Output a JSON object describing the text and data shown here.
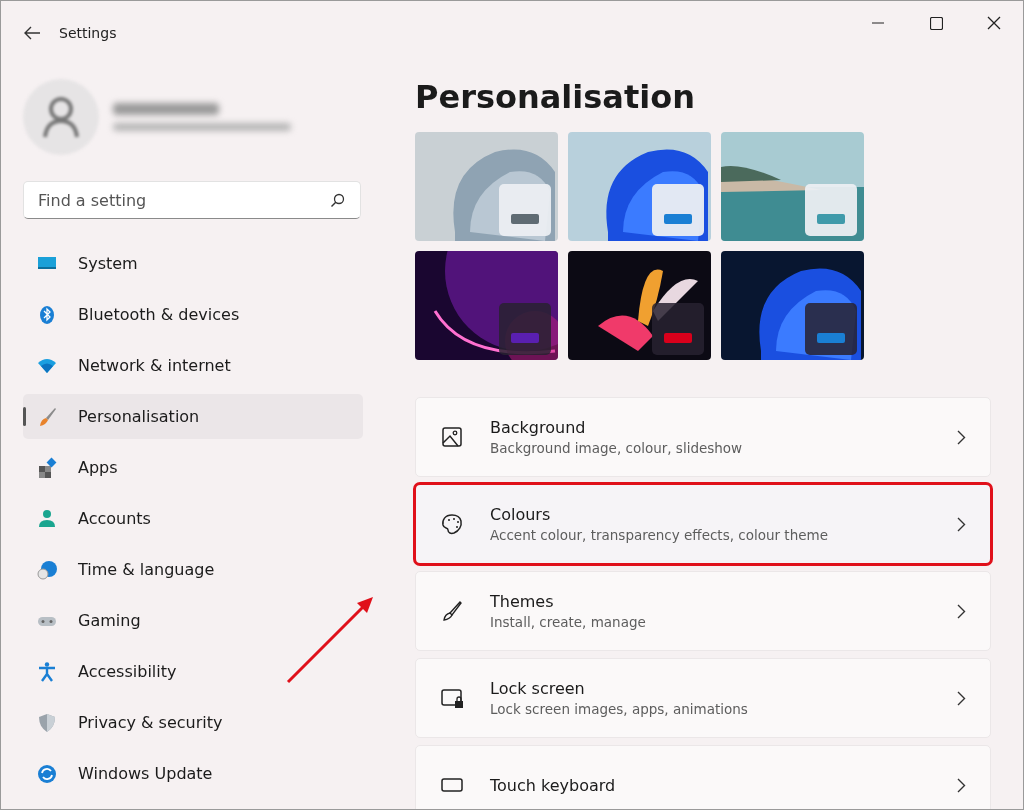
{
  "window": {
    "title": "Settings"
  },
  "search": {
    "placeholder": "Find a setting"
  },
  "nav": [
    {
      "label": "System",
      "selected": false
    },
    {
      "label": "Bluetooth & devices",
      "selected": false
    },
    {
      "label": "Network & internet",
      "selected": false
    },
    {
      "label": "Personalisation",
      "selected": true
    },
    {
      "label": "Apps",
      "selected": false
    },
    {
      "label": "Accounts",
      "selected": false
    },
    {
      "label": "Time & language",
      "selected": false
    },
    {
      "label": "Gaming",
      "selected": false
    },
    {
      "label": "Accessibility",
      "selected": false
    },
    {
      "label": "Privacy & security",
      "selected": false
    },
    {
      "label": "Windows Update",
      "selected": false
    }
  ],
  "page_title": "Personalisation",
  "themes": [
    {
      "kind": "picture",
      "dark": false,
      "color": "#5f6b73"
    },
    {
      "kind": "picture",
      "dark": false,
      "color": "#1a7fd4"
    },
    {
      "kind": "picture",
      "dark": false,
      "color": "#3f9aaa"
    },
    {
      "kind": "picture",
      "dark": true,
      "color": "#5a1fb0"
    },
    {
      "kind": "picture",
      "dark": true,
      "color": "#d9001b"
    },
    {
      "kind": "picture",
      "dark": true,
      "color": "#1a7fd4"
    }
  ],
  "settings": [
    {
      "title": "Background",
      "subtitle": "Background image, colour, slideshow",
      "highlighted": false
    },
    {
      "title": "Colours",
      "subtitle": "Accent colour, transparency effects, colour theme",
      "highlighted": true
    },
    {
      "title": "Themes",
      "subtitle": "Install, create, manage",
      "highlighted": false
    },
    {
      "title": "Lock screen",
      "subtitle": "Lock screen images, apps, animations",
      "highlighted": false
    },
    {
      "title": "Touch keyboard",
      "highlighted": false
    }
  ]
}
